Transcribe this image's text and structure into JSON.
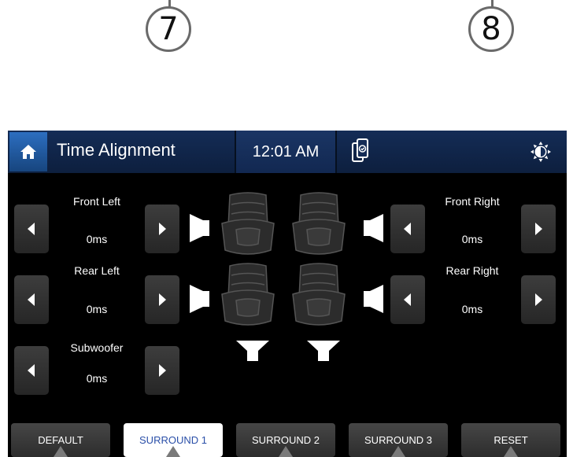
{
  "callouts": [
    "7",
    "8"
  ],
  "header": {
    "title": "Time Alignment",
    "time": "12:01 AM",
    "icons": [
      "home-icon",
      "phone-link-icon",
      "brightness-icon"
    ]
  },
  "channels": {
    "front_left": {
      "label": "Front Left",
      "value": "0ms"
    },
    "rear_left": {
      "label": "Rear Left",
      "value": "0ms"
    },
    "subwoofer": {
      "label": "Subwoofer",
      "value": "0ms"
    },
    "front_right": {
      "label": "Front Right",
      "value": "0ms"
    },
    "rear_right": {
      "label": "Rear Right",
      "value": "0ms"
    }
  },
  "tabs": [
    {
      "label": "DEFAULT",
      "active": false
    },
    {
      "label": "SURROUND 1",
      "active": true
    },
    {
      "label": "SURROUND 2",
      "active": false
    },
    {
      "label": "SURROUND 3",
      "active": false
    },
    {
      "label": "RESET",
      "active": false
    }
  ],
  "colors": {
    "header_bg": "#142c56",
    "home_button": "#2c6ec0",
    "active_tab_text": "#2a4fa8",
    "button_bg": "#333333"
  }
}
